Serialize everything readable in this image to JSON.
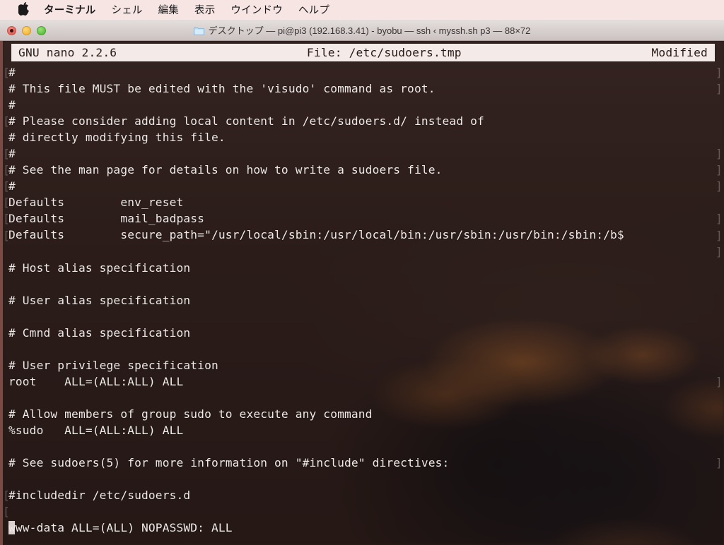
{
  "menubar": {
    "apple_icon": "apple-logo-icon",
    "items": [
      {
        "label": "ターミナル",
        "bold": true
      },
      {
        "label": "シェル",
        "bold": false
      },
      {
        "label": "編集",
        "bold": false
      },
      {
        "label": "表示",
        "bold": false
      },
      {
        "label": "ウインドウ",
        "bold": false
      },
      {
        "label": "ヘルプ",
        "bold": false
      }
    ]
  },
  "window": {
    "title": "デスクトップ — pi@pi3 (192.168.3.41) - byobu — ssh ‹ myssh.sh p3 — 88×72",
    "folder_icon": "folder-icon",
    "controls": {
      "close_label": "close",
      "minimize_label": "minimize",
      "zoom_label": "zoom"
    }
  },
  "nano": {
    "version": "GNU nano 2.2.6",
    "file_label": "File: /etc/sudoers.tmp",
    "state": "Modified",
    "lines": [
      "#",
      "# This file MUST be edited with the 'visudo' command as root.",
      "#",
      "# Please consider adding local content in /etc/sudoers.d/ instead of",
      "# directly modifying this file.",
      "#",
      "# See the man page for details on how to write a sudoers file.",
      "#",
      "Defaults        env_reset",
      "Defaults        mail_badpass",
      "Defaults        secure_path=\"/usr/local/sbin:/usr/local/bin:/usr/sbin:/usr/bin:/sbin:/b$",
      "",
      "# Host alias specification",
      "",
      "# User alias specification",
      "",
      "# Cmnd alias specification",
      "",
      "# User privilege specification",
      "root    ALL=(ALL:ALL) ALL",
      "",
      "# Allow members of group sudo to execute any command",
      "%sudo   ALL=(ALL:ALL) ALL",
      "",
      "# See sudoers(5) for more information on \"#include\" directives:",
      "",
      "#includedir /etc/sudoers.d",
      "",
      "www-data ALL=(ALL) NOPASSWD: ALL"
    ],
    "left_marks": [
      "[",
      "[",
      "[",
      "[",
      "[",
      "[",
      "[",
      "[",
      "[",
      "["
    ],
    "right_marks": [
      "]",
      "]",
      "]",
      "]",
      "]",
      "]",
      "]",
      "]"
    ]
  },
  "colors": {
    "menubar_bg": "#f7e5e4",
    "titlebar_bg": "#d6cfce",
    "terminal_bg": "#2d1d1a",
    "terminal_fg": "#f2ece8",
    "nano_header_bg": "#f4eae7",
    "window_border": "#7b4a44",
    "close_light": "#e8665c",
    "min_light": "#f7bd42",
    "max_light": "#62c544"
  }
}
